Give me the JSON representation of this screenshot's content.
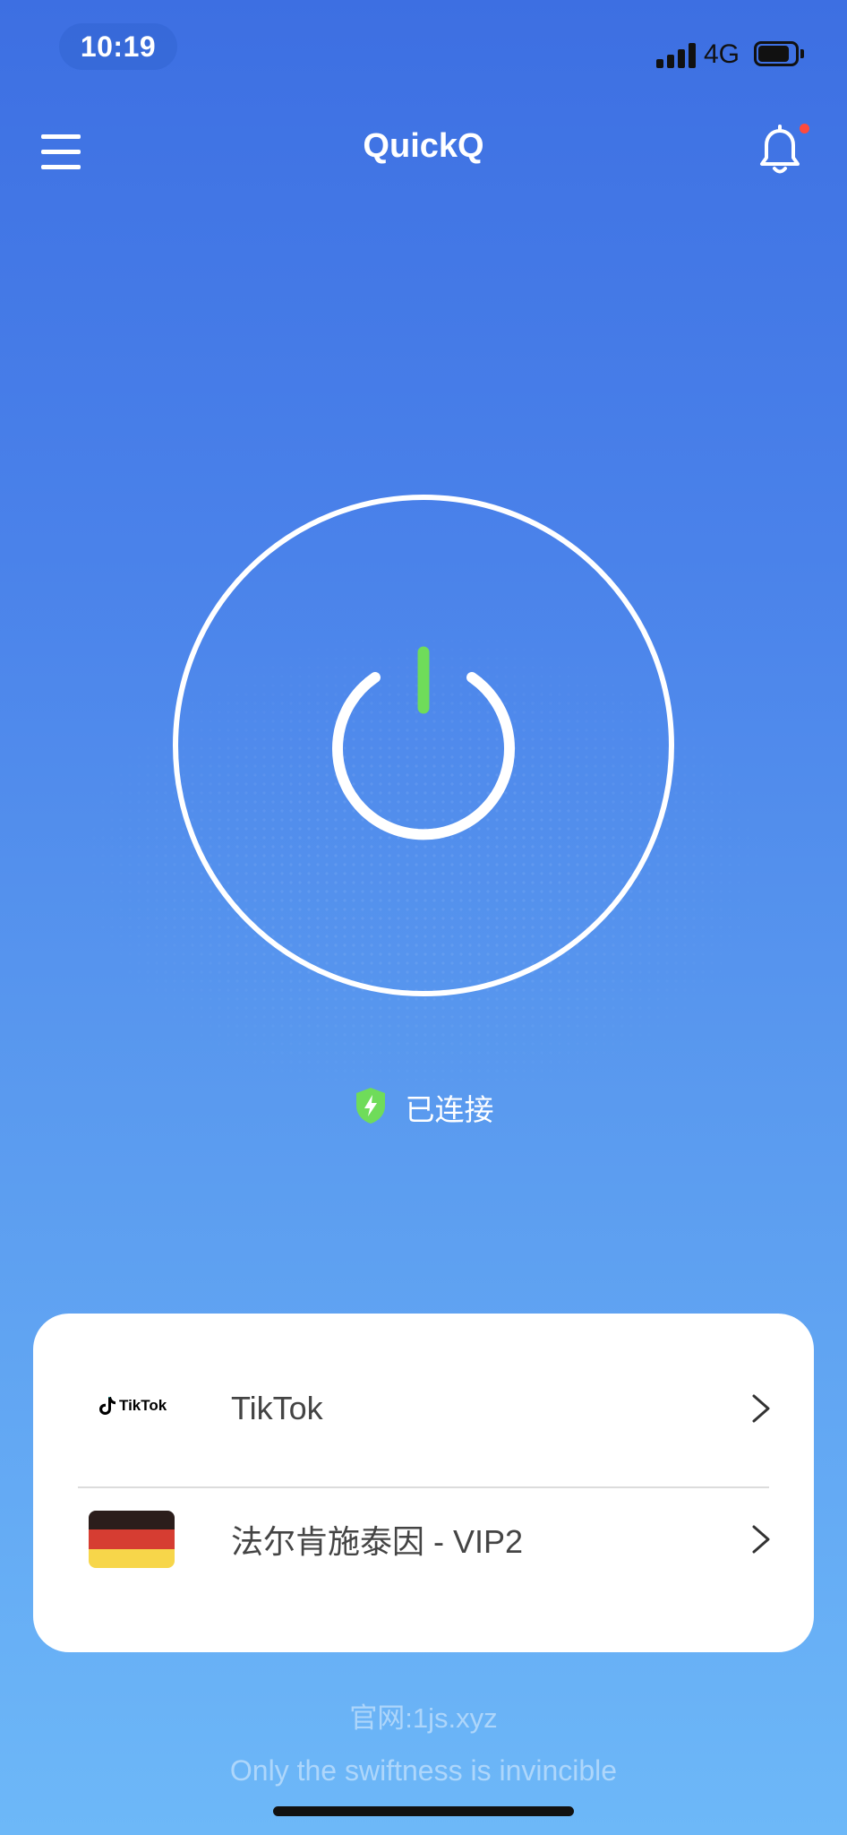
{
  "status_bar": {
    "time": "10:19",
    "network": "4G",
    "battery_level": 0.75
  },
  "header": {
    "title": "QuickQ",
    "menu_icon": "hamburger-icon",
    "notification_icon": "bell-icon",
    "has_unread_notification": true
  },
  "connection": {
    "power_icon": "power-icon",
    "status_icon": "shield-bolt-icon",
    "status_text": "已连接"
  },
  "card": {
    "rows": [
      {
        "icon": "tiktok-logo",
        "logo_text": "TikTok",
        "label": "TikTok"
      },
      {
        "icon": "germany-flag-icon",
        "label": "法尔肯施泰因 - VIP2"
      }
    ]
  },
  "footer": {
    "website": "官网:1js.xyz",
    "slogan": "Only the swiftness is invincible"
  },
  "colors": {
    "accent_green": "#6fdc5a",
    "notification_dot": "#ff4a3d",
    "background_top": "#3d6fe2",
    "background_bottom": "#6db8f8"
  }
}
